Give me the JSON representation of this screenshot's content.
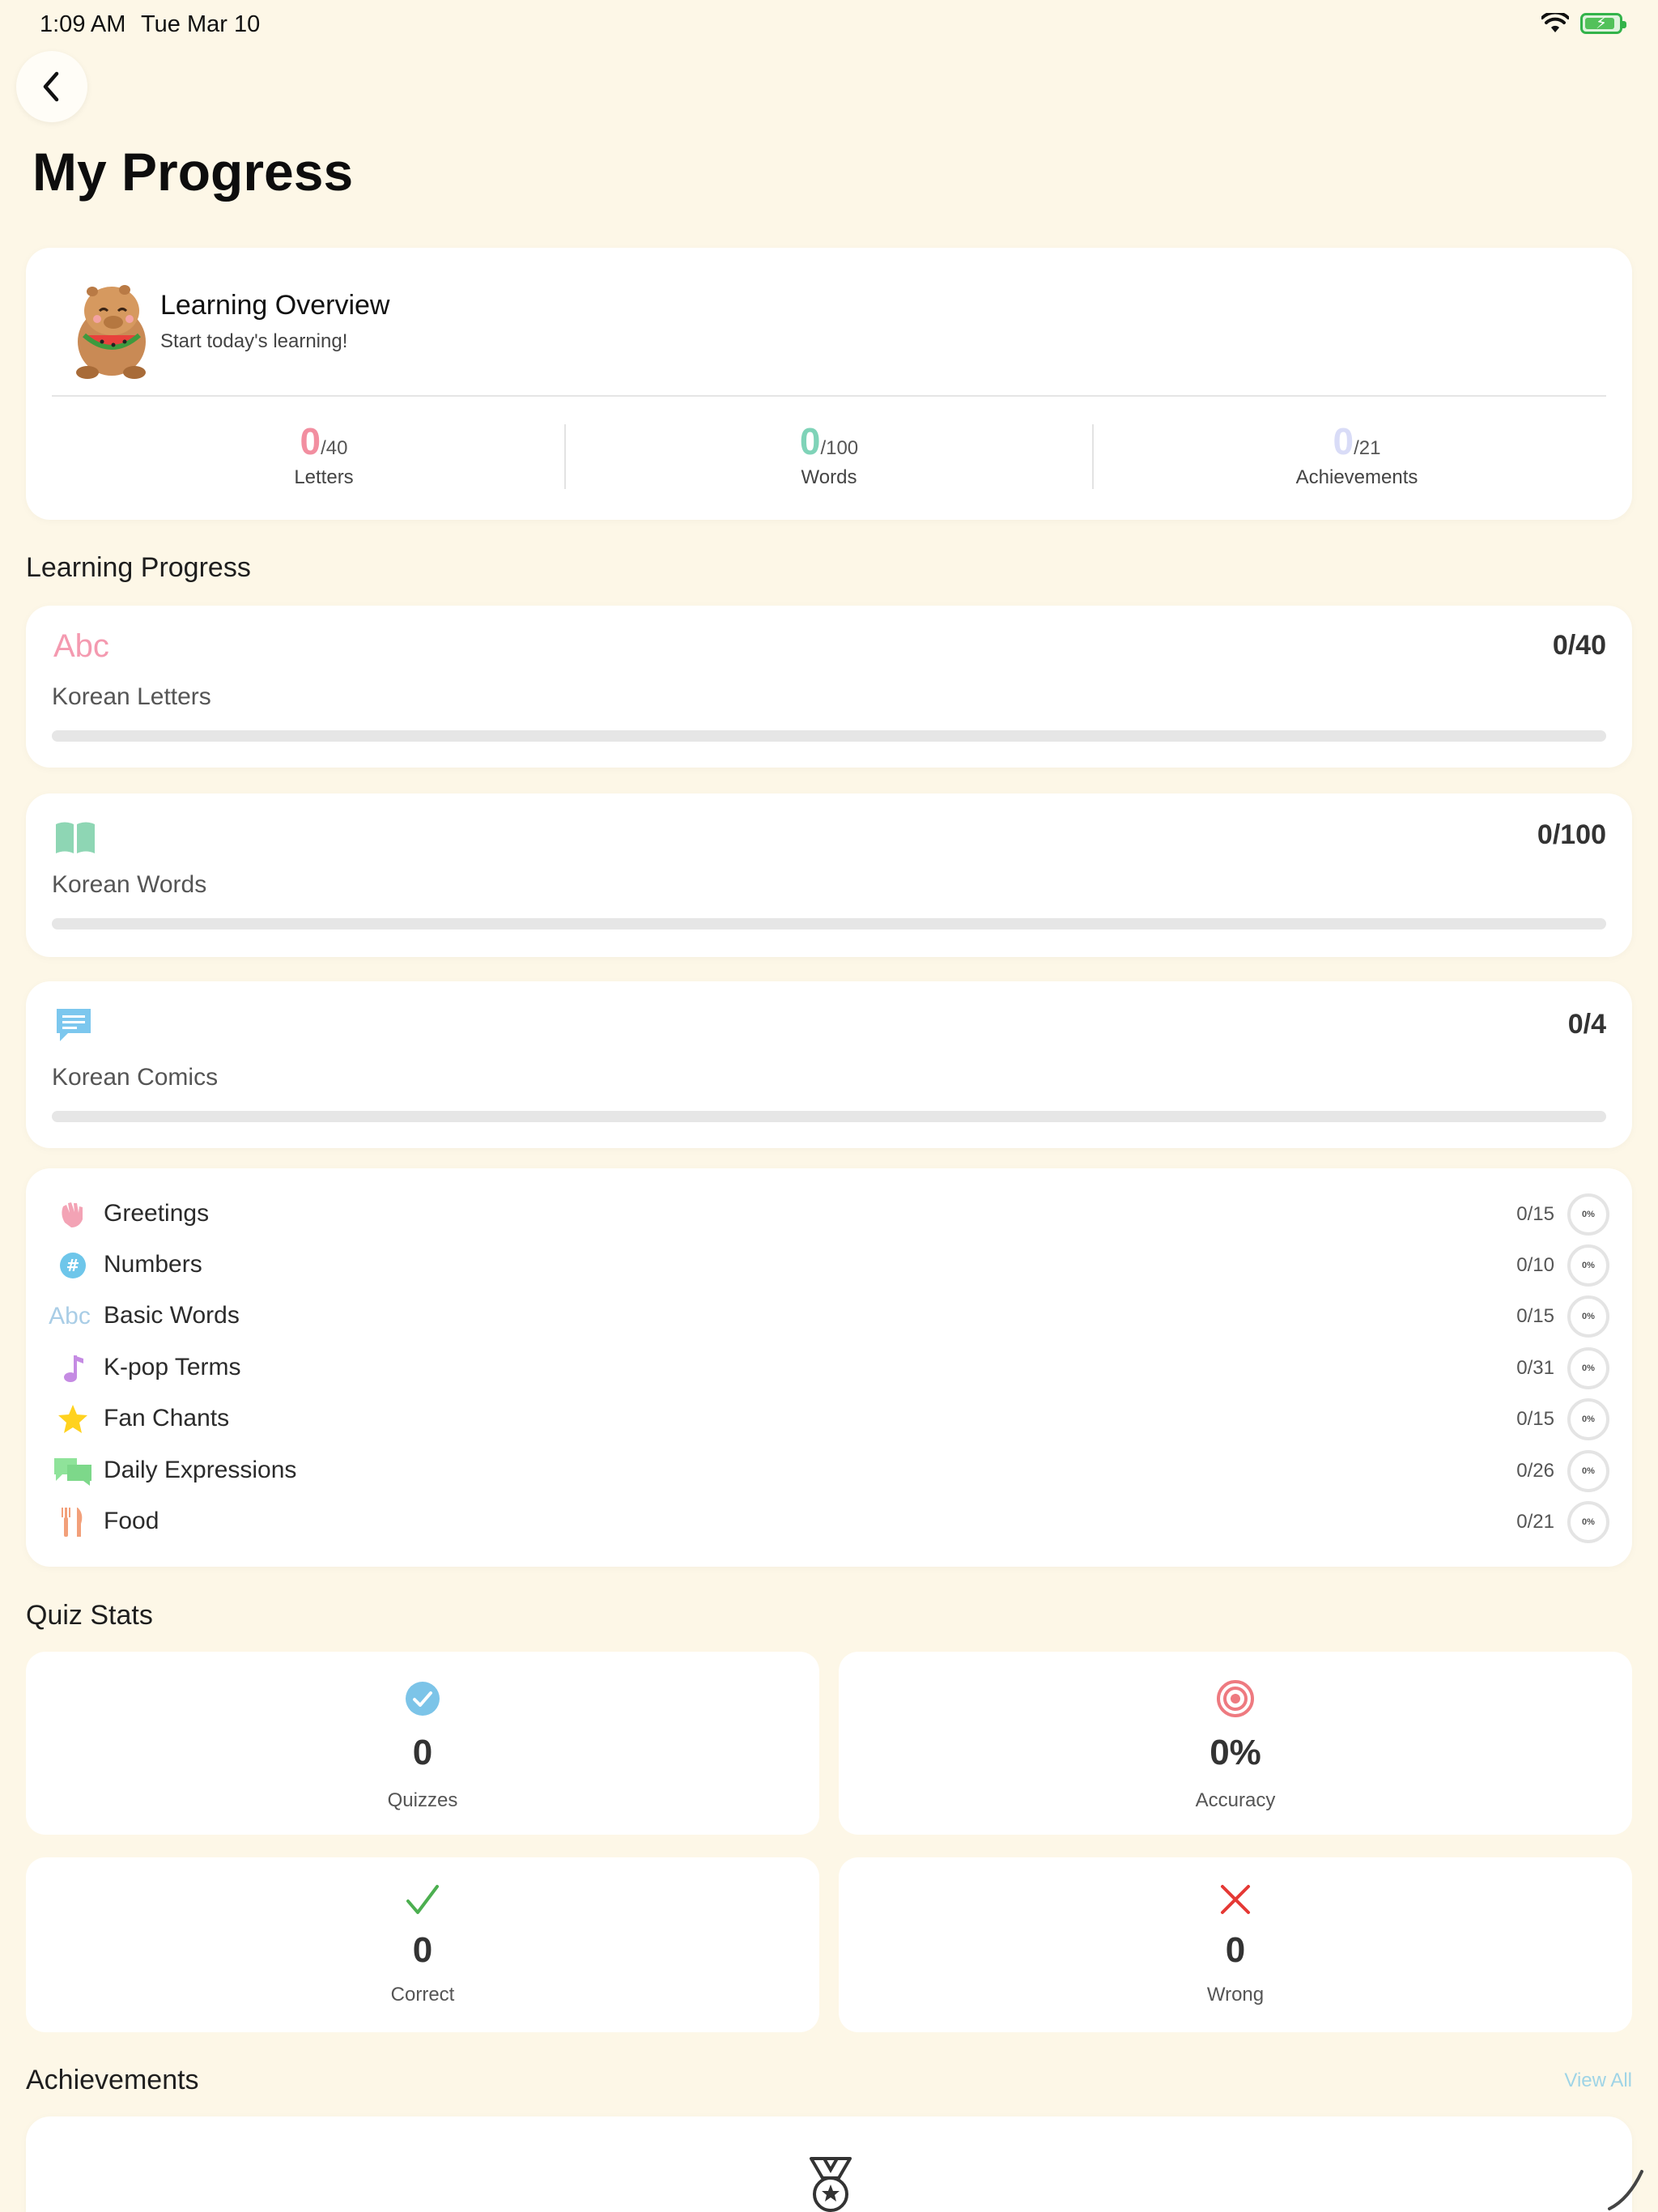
{
  "status_bar": {
    "time": "1:09 AM",
    "date": "Tue Mar 10"
  },
  "page": {
    "title": "My Progress"
  },
  "overview": {
    "title": "Learning Overview",
    "subtitle": "Start today's learning!",
    "stats": [
      {
        "value": "0",
        "total": "/40",
        "label": "Letters",
        "color": "#f28ea0"
      },
      {
        "value": "0",
        "total": "/100",
        "label": "Words",
        "color": "#7fd3b8"
      },
      {
        "value": "0",
        "total": "/21",
        "label": "Achievements",
        "color": "#d9dcf7"
      }
    ]
  },
  "learning_progress": {
    "title": "Learning Progress",
    "items": [
      {
        "label": "Korean Letters",
        "count": "0/40",
        "icon": "abc-icon",
        "icon_text": "Abc",
        "color": "#f49ab0",
        "progress": 0
      },
      {
        "label": "Korean Words",
        "count": "0/100",
        "icon": "book-icon",
        "color": "#8ed6b4",
        "progress": 0
      },
      {
        "label": "Korean Comics",
        "count": "0/4",
        "icon": "chat-bubble-icon",
        "color": "#7cc7ee",
        "progress": 0
      }
    ]
  },
  "categories": [
    {
      "name": "Greetings",
      "count": "0/15",
      "percent": "0%",
      "icon": "waving-hand-icon",
      "color": "#f3a3b5"
    },
    {
      "name": "Numbers",
      "count": "0/10",
      "percent": "0%",
      "icon": "number-sign-icon",
      "color": "#6ec6ea"
    },
    {
      "name": "Basic Words",
      "count": "0/15",
      "percent": "0%",
      "icon": "abc-icon",
      "icon_text": "Abc",
      "color": "#a9cde6"
    },
    {
      "name": "K-pop Terms",
      "count": "0/31",
      "percent": "0%",
      "icon": "music-note-icon",
      "color": "#c58be3"
    },
    {
      "name": "Fan Chants",
      "count": "0/15",
      "percent": "0%",
      "icon": "star-icon",
      "color": "#ffd21f"
    },
    {
      "name": "Daily Expressions",
      "count": "0/26",
      "percent": "0%",
      "icon": "speech-bubbles-icon",
      "color": "#8fe39a"
    },
    {
      "name": "Food",
      "count": "0/21",
      "percent": "0%",
      "icon": "fork-knife-icon",
      "color": "#f2a07a"
    }
  ],
  "quiz_stats": {
    "title": "Quiz Stats",
    "cards": [
      {
        "value": "0",
        "label": "Quizzes",
        "icon": "check-circle-icon",
        "color": "#7cc4e8"
      },
      {
        "value": "0%",
        "label": "Accuracy",
        "icon": "target-icon",
        "color": "#ee7a80"
      },
      {
        "value": "0",
        "label": "Correct",
        "icon": "checkmark-icon",
        "color": "#4caf50"
      },
      {
        "value": "0",
        "label": "Wrong",
        "icon": "x-mark-icon",
        "color": "#e53935"
      }
    ]
  },
  "achievements": {
    "title": "Achievements",
    "view_all": "View All"
  }
}
